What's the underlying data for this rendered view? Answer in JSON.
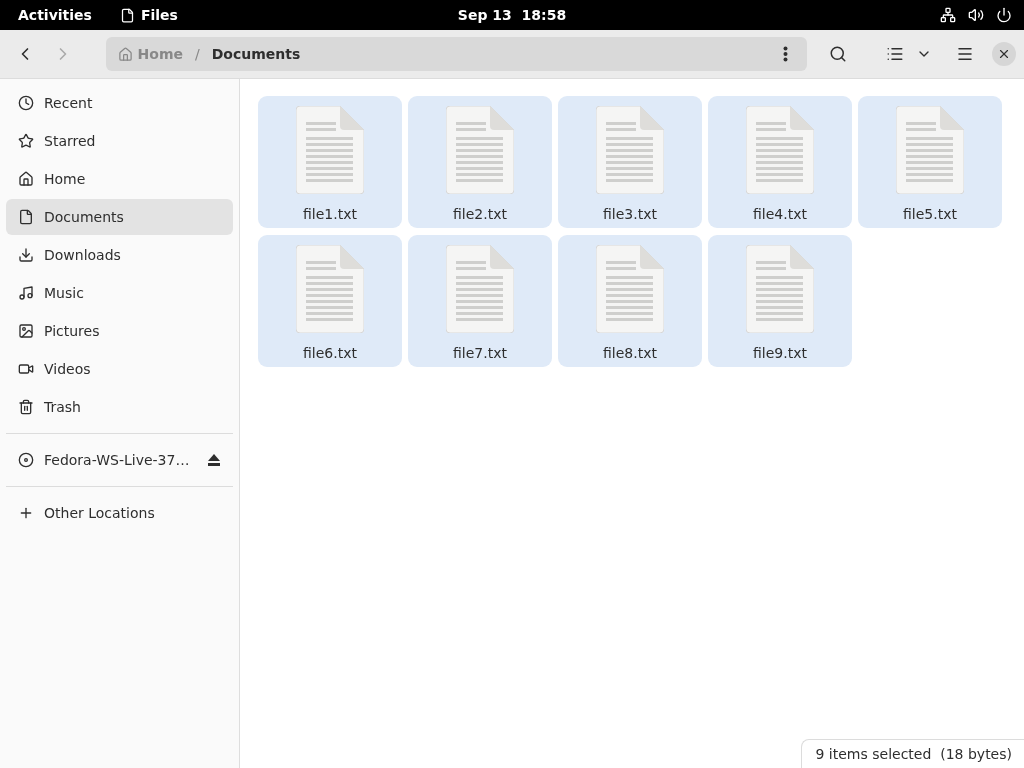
{
  "top_bar": {
    "activities": "Activities",
    "app": "Files",
    "date": "Sep 13",
    "time": "18:58"
  },
  "header": {
    "back_disabled": false,
    "forward_disabled": true,
    "path": [
      {
        "label": "Home",
        "selected": false
      },
      {
        "label": "Documents",
        "selected": true
      }
    ],
    "separator": "/"
  },
  "sidebar": {
    "places": [
      {
        "label": "Recent",
        "selected": false
      },
      {
        "label": "Starred",
        "selected": false
      },
      {
        "label": "Home",
        "selected": false
      },
      {
        "label": "Documents",
        "selected": true
      },
      {
        "label": "Downloads",
        "selected": false
      },
      {
        "label": "Music",
        "selected": false
      },
      {
        "label": "Pictures",
        "selected": false
      },
      {
        "label": "Videos",
        "selected": false
      },
      {
        "label": "Trash",
        "selected": false
      }
    ],
    "devices": [
      {
        "label": "Fedora-WS-Live-37…",
        "selected": false
      }
    ],
    "other": [
      {
        "label": "Other Locations",
        "selected": false
      }
    ]
  },
  "files": [
    {
      "name": "file1.txt",
      "selected": true
    },
    {
      "name": "file2.txt",
      "selected": true
    },
    {
      "name": "file3.txt",
      "selected": true
    },
    {
      "name": "file4.txt",
      "selected": true
    },
    {
      "name": "file5.txt",
      "selected": true
    },
    {
      "name": "file6.txt",
      "selected": true
    },
    {
      "name": "file7.txt",
      "selected": true
    },
    {
      "name": "file8.txt",
      "selected": true
    },
    {
      "name": "file9.txt",
      "selected": true
    }
  ],
  "status": "9 items selected  (18 bytes)"
}
